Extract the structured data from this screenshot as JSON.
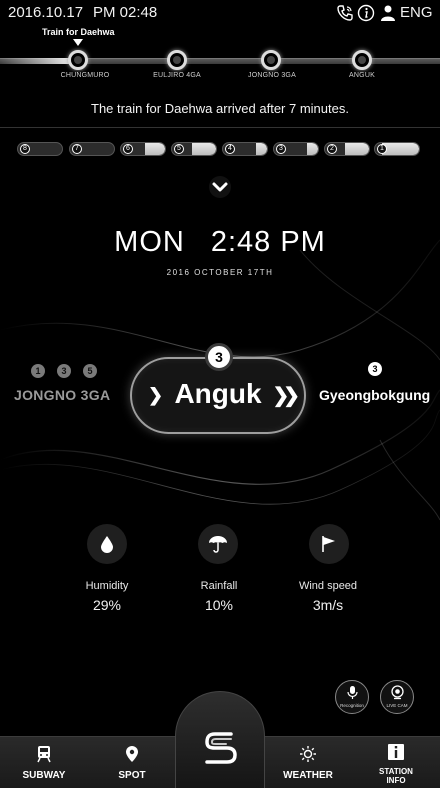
{
  "status": {
    "date": "2016.10.17",
    "time": "PM 02:48",
    "language": "ENG",
    "icons": [
      "phone-icon",
      "info-icon",
      "person-icon"
    ]
  },
  "route": {
    "train_label": "Train for Daehwa",
    "stations": [
      "CHUNGMURO",
      "EULJIRO 4GA",
      "JONGNO 3GA",
      "ANGUK"
    ]
  },
  "arrival_message": "The train for Daehwa arrived after 7 minutes.",
  "cars": [
    {
      "number": "8",
      "fill": 0.0
    },
    {
      "number": "7",
      "fill": 0.0
    },
    {
      "number": "6",
      "fill": 0.45
    },
    {
      "number": "5",
      "fill": 0.55
    },
    {
      "number": "4",
      "fill": 0.25
    },
    {
      "number": "3",
      "fill": 0.25
    },
    {
      "number": "2",
      "fill": 0.55
    },
    {
      "number": "1",
      "fill": 0.85
    }
  ],
  "clock": {
    "day": "MON",
    "time": "2:48 PM",
    "date": "2016 OCTOBER 17TH"
  },
  "selector": {
    "prev_lines": [
      "1",
      "3",
      "5"
    ],
    "prev_station": "JONGNO 3GA",
    "current_line": "3",
    "current_station": "Anguk",
    "next_line": "3",
    "next_station": "Gyeongbokgung"
  },
  "weather": [
    {
      "icon": "drop-icon",
      "label": "Humidity",
      "value": "29%"
    },
    {
      "icon": "umbrella-icon",
      "label": "Rainfall",
      "value": "10%"
    },
    {
      "icon": "flag-icon",
      "label": "Wind speed",
      "value": "3m/s"
    }
  ],
  "buttons": {
    "recognition": "Recognition",
    "live_cam": "LIVE CAM"
  },
  "nav": {
    "subway": "SUBWAY",
    "spot": "SPOT",
    "weather": "WEATHER",
    "station_info_line1": "STATION",
    "station_info_line2": "INFO"
  }
}
